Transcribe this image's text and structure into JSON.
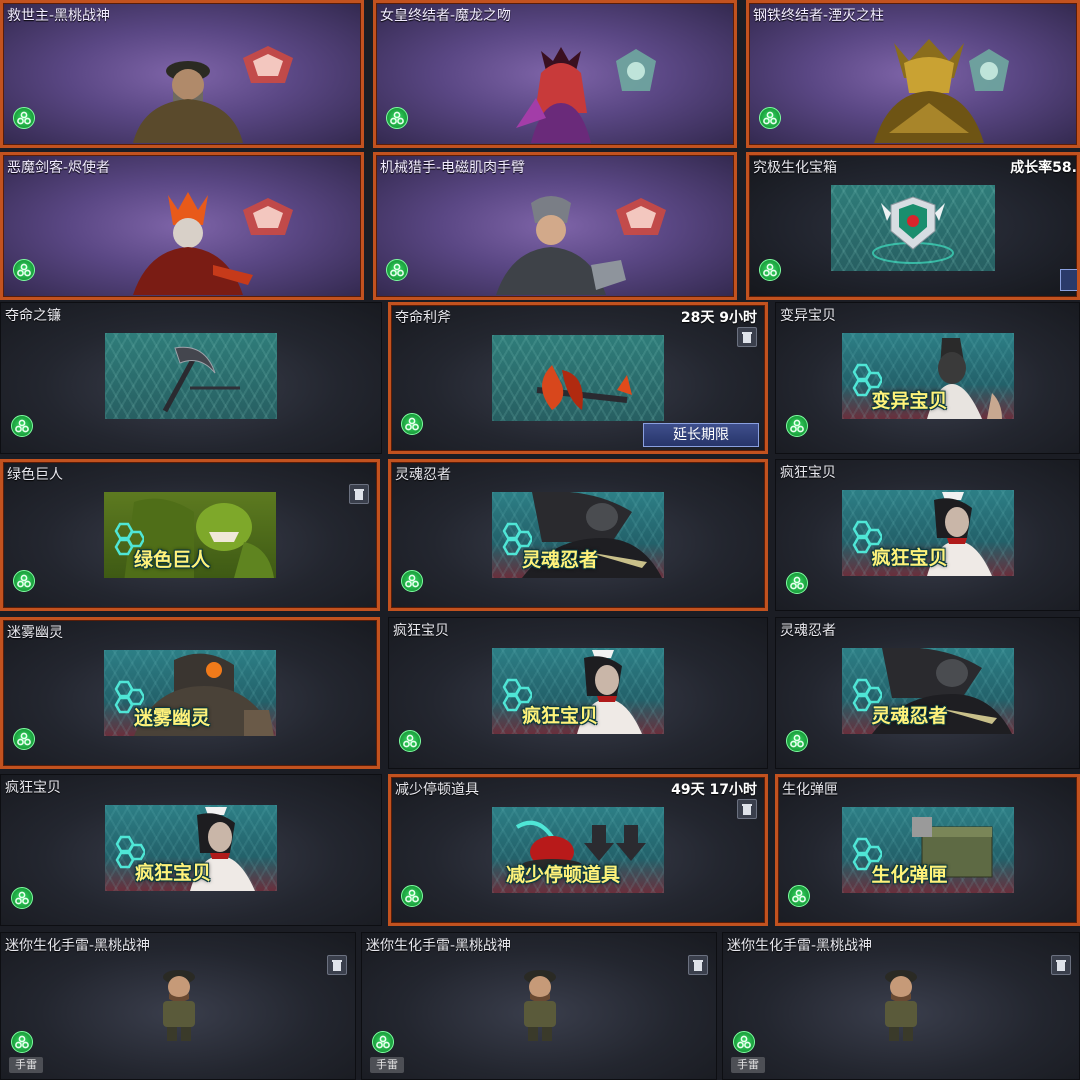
{
  "cards": [
    {
      "title": "救世主-黑桃战神",
      "style": "purple",
      "selected": true,
      "type": "hero"
    },
    {
      "title": "女皇终结者-魔龙之吻",
      "style": "purple",
      "selected": true,
      "type": "hero"
    },
    {
      "title": "钢铁终结者-湮灭之柱",
      "style": "purple",
      "selected": true,
      "type": "hero"
    },
    {
      "title": "恶魔剑客-烬使者",
      "style": "purple",
      "selected": true,
      "type": "hero"
    },
    {
      "title": "机械猎手-电磁肌肉手臂",
      "style": "purple",
      "selected": true,
      "type": "hero"
    },
    {
      "title": "究极生化宝箱",
      "style": "dark",
      "selected": true,
      "type": "chest",
      "rate": "成长率58."
    },
    {
      "title": "夺命之镰",
      "type": "weapon"
    },
    {
      "title": "夺命利斧",
      "type": "weapon",
      "selected": true,
      "timer": "28天 9小时",
      "button": "延长期限",
      "trash": true
    },
    {
      "title": "变异宝贝",
      "type": "zombie",
      "banner_text": "变异宝贝"
    },
    {
      "title": "绿色巨人",
      "type": "zombie",
      "selected": true,
      "banner_text": "绿色巨人",
      "trash": true
    },
    {
      "title": "灵魂忍者",
      "type": "zombie",
      "selected": true,
      "banner_text": "灵魂忍者"
    },
    {
      "title": "疯狂宝贝",
      "type": "zombie",
      "banner_text": "疯狂宝贝"
    },
    {
      "title": "迷雾幽灵",
      "type": "zombie",
      "selected": true,
      "banner_text": "迷雾幽灵"
    },
    {
      "title": "疯狂宝贝",
      "type": "zombie",
      "banner_text": "疯狂宝贝"
    },
    {
      "title": "灵魂忍者",
      "type": "zombie",
      "banner_text": "灵魂忍者"
    },
    {
      "title": "疯狂宝贝",
      "type": "zombie",
      "banner_text": "疯狂宝贝"
    },
    {
      "title": "减少停顿道具",
      "type": "item",
      "selected": true,
      "timer": "49天 17小时",
      "banner_text": "减少停顿道具",
      "trash": true
    },
    {
      "title": "生化弹匣",
      "type": "item",
      "selected": true,
      "banner_text": "生化弹匣"
    },
    {
      "title": "迷你生化手雷-黑桃战神",
      "type": "grenade",
      "tag": "手雷",
      "trash": true
    },
    {
      "title": "迷你生化手雷-黑桃战神",
      "type": "grenade",
      "tag": "手雷",
      "trash": true
    },
    {
      "title": "迷你生化手雷-黑桃战神",
      "type": "grenade",
      "tag": "手雷",
      "trash": true
    }
  ],
  "icons": {
    "bio": "biohazard-icon",
    "trash": "trash-icon"
  },
  "colors": {
    "selected_border": "#c2521f",
    "accent_green": "#37e067",
    "banner_text": "#fff27a"
  }
}
